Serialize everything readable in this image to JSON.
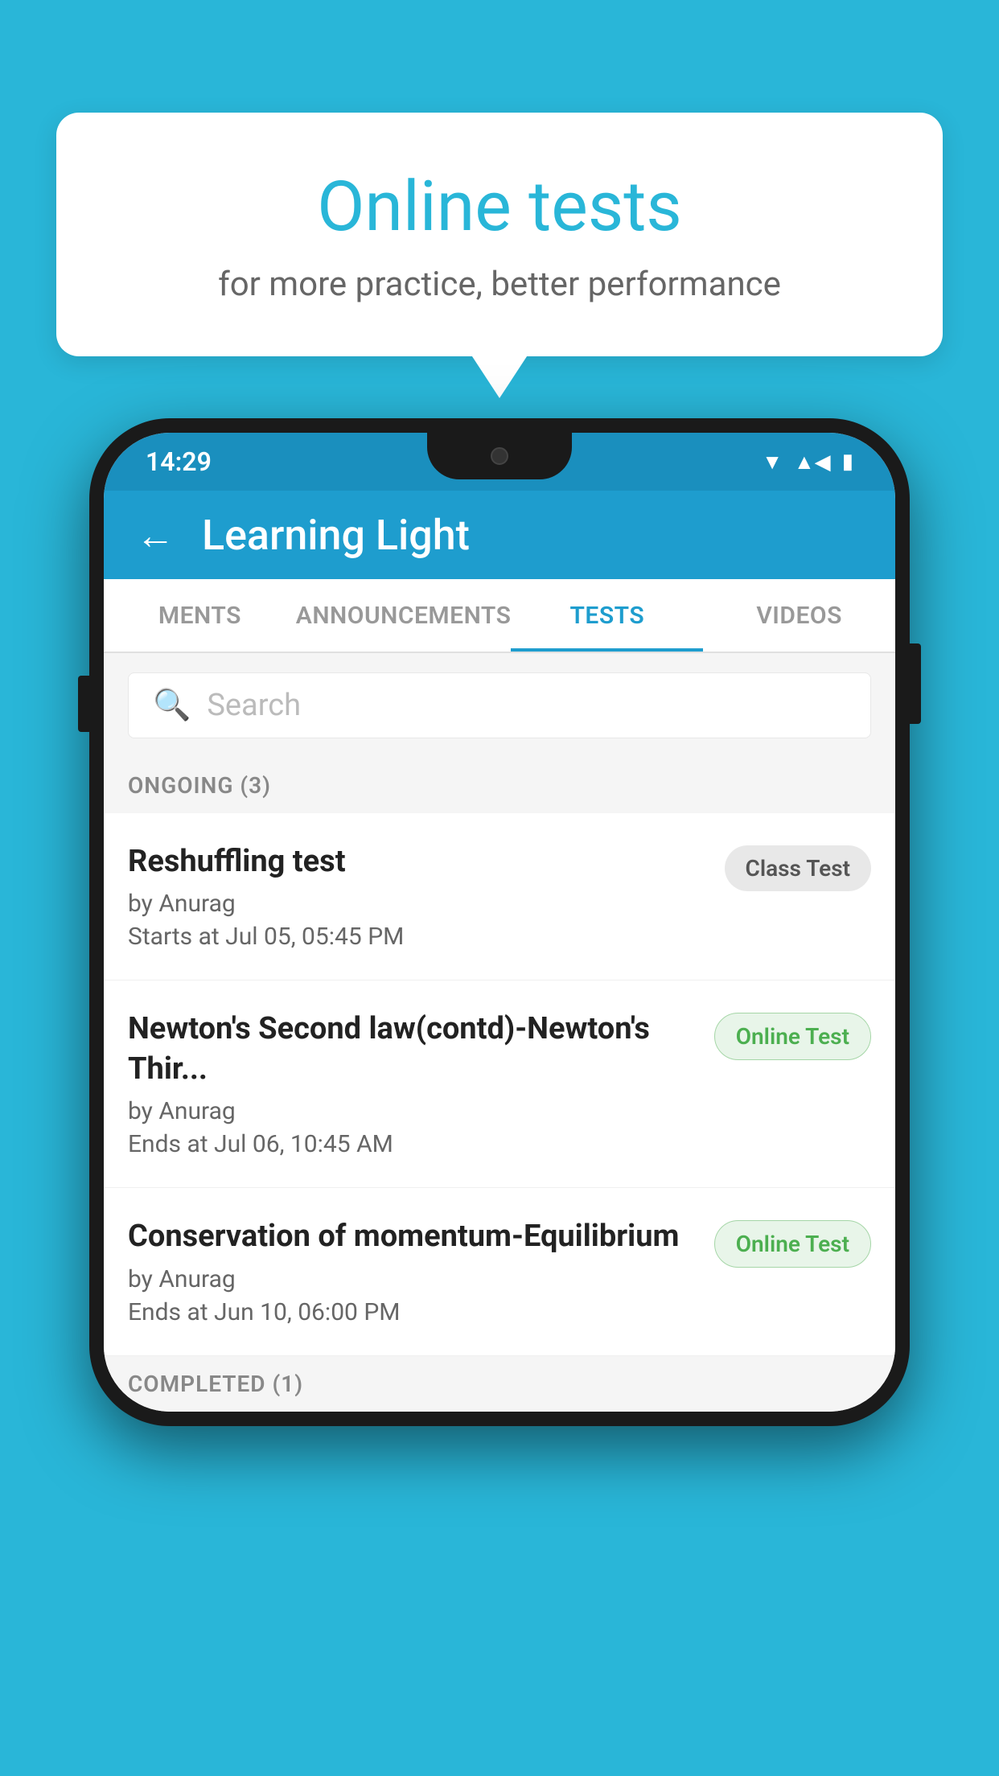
{
  "background": {
    "color": "#29b6d8"
  },
  "bubble": {
    "title": "Online tests",
    "subtitle": "for more practice, better performance"
  },
  "phone": {
    "statusBar": {
      "time": "14:29",
      "icons": [
        "wifi",
        "signal",
        "battery"
      ]
    },
    "appBar": {
      "title": "Learning Light",
      "backLabel": "←"
    },
    "tabs": [
      {
        "label": "MENTS",
        "active": false
      },
      {
        "label": "ANNOUNCEMENTS",
        "active": false
      },
      {
        "label": "TESTS",
        "active": true
      },
      {
        "label": "VIDEOS",
        "active": false
      }
    ],
    "search": {
      "placeholder": "Search"
    },
    "ongoingSection": {
      "label": "ONGOING (3)"
    },
    "tests": [
      {
        "title": "Reshuffling test",
        "by": "by Anurag",
        "date": "Starts at  Jul 05, 05:45 PM",
        "badge": "Class Test",
        "badgeType": "class"
      },
      {
        "title": "Newton's Second law(contd)-Newton's Thir...",
        "by": "by Anurag",
        "date": "Ends at  Jul 06, 10:45 AM",
        "badge": "Online Test",
        "badgeType": "online"
      },
      {
        "title": "Conservation of momentum-Equilibrium",
        "by": "by Anurag",
        "date": "Ends at  Jun 10, 06:00 PM",
        "badge": "Online Test",
        "badgeType": "online"
      }
    ],
    "completedSection": {
      "label": "COMPLETED (1)"
    }
  }
}
